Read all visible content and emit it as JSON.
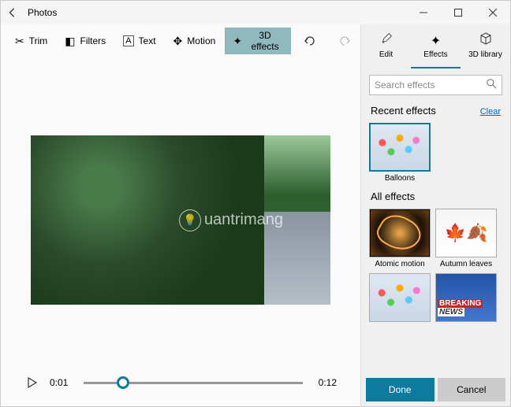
{
  "app": {
    "title": "Photos"
  },
  "toolbar": {
    "trim": "Trim",
    "filters": "Filters",
    "text": "Text",
    "motion": "Motion",
    "effects3d": "3D effects"
  },
  "preview": {
    "watermark": "uantrimang"
  },
  "timeline": {
    "current": "0:01",
    "total": "0:12"
  },
  "sidebar": {
    "tabs": {
      "edit": "Edit",
      "effects": "Effects",
      "library": "3D library"
    },
    "search_placeholder": "Search effects",
    "recent_title": "Recent effects",
    "clear": "Clear",
    "all_title": "All effects",
    "recent": [
      {
        "label": "Balloons"
      }
    ],
    "all": [
      {
        "label": "Atomic motion"
      },
      {
        "label": "Autumn leaves"
      },
      {
        "label": ""
      },
      {
        "label": ""
      }
    ],
    "done": "Done",
    "cancel": "Cancel"
  }
}
